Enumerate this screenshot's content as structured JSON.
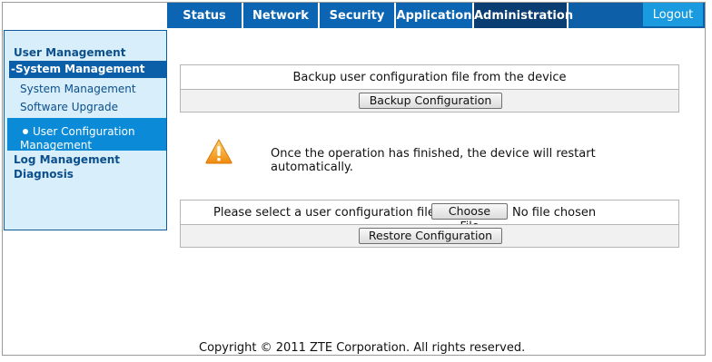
{
  "nav": {
    "tabs": [
      {
        "label": "Status"
      },
      {
        "label": "Network"
      },
      {
        "label": "Security"
      },
      {
        "label": "Application"
      },
      {
        "label": "Administration"
      }
    ],
    "logout": "Logout"
  },
  "sidebar": {
    "user_management": "User Management",
    "system_management_head": "-System Management",
    "system_management": "System Management",
    "software_upgrade": "Software Upgrade",
    "user_configuration_management": "User Configuration Management",
    "log_management": "Log Management",
    "diagnosis": "Diagnosis"
  },
  "backup": {
    "description": "Backup user configuration file from the device",
    "button": "Backup Configuration"
  },
  "notice": {
    "message": "Once the operation has finished, the device will restart automatically."
  },
  "restore": {
    "prompt": "Please select a user configuration file",
    "choose_file_button": "Choose File",
    "file_status": "No file chosen",
    "button": "Restore Configuration"
  },
  "footer": {
    "copyright": "Copyright © 2011 ZTE Corporation. All rights reserved."
  },
  "colors": {
    "nav_bg": "#0b65b3",
    "nav_active": "#0a3e72",
    "logout_bg": "#1a9be0",
    "sidebar_bg": "#d8eefa",
    "warning": "#f39c12"
  }
}
